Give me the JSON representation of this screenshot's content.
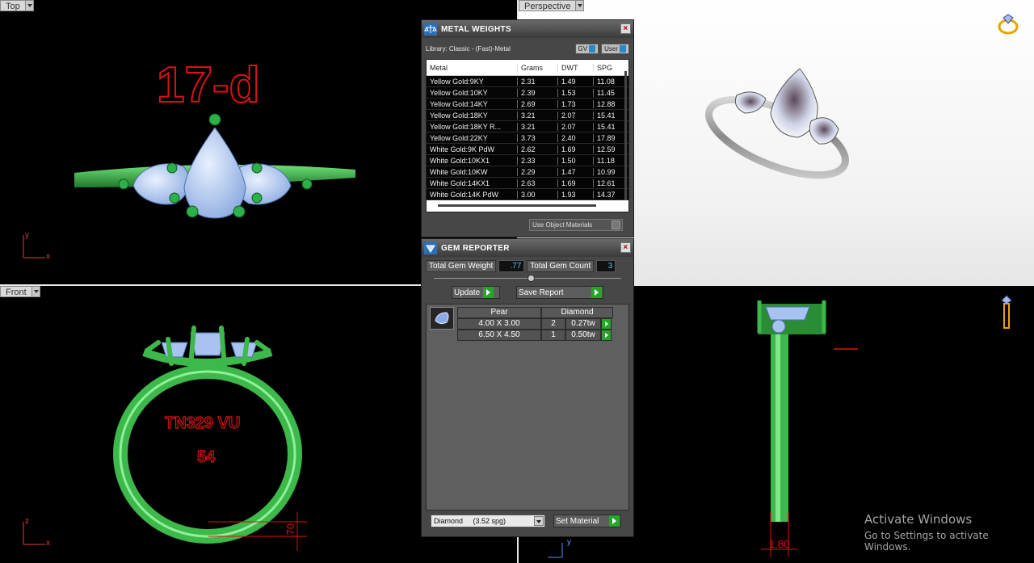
{
  "viewports": {
    "top": {
      "label": "Top",
      "design_text": "17-d",
      "axis_x": "x",
      "axis_y": "y"
    },
    "perspective": {
      "label": "Perspective"
    },
    "front": {
      "label": "Front",
      "engraving_line1": "TN329 VU",
      "engraving_line2": "54",
      "dimension": ".70",
      "axis_x": "x",
      "axis_z": "z"
    },
    "right": {
      "dimension": "1.80",
      "axis_y": "y"
    }
  },
  "metal_weights": {
    "title": "METAL WEIGHTS",
    "library": "Library: Classic - (Fast)-Metal",
    "gv_label": "GV",
    "user_label": "User",
    "columns": [
      "Metal",
      "Grams",
      "DWT",
      "SPG"
    ],
    "rows": [
      {
        "metal": "Yellow Gold:9KY",
        "grams": "2.31",
        "dwt": "1.49",
        "spg": "11.08"
      },
      {
        "metal": "Yellow Gold:10KY",
        "grams": "2.39",
        "dwt": "1.53",
        "spg": "11.45"
      },
      {
        "metal": "Yellow Gold:14KY",
        "grams": "2.69",
        "dwt": "1.73",
        "spg": "12.88"
      },
      {
        "metal": "Yellow Gold:18KY",
        "grams": "3.21",
        "dwt": "2.07",
        "spg": "15.41"
      },
      {
        "metal": "Yellow Gold:18KY R...",
        "grams": "3.21",
        "dwt": "2.07",
        "spg": "15.41"
      },
      {
        "metal": "Yellow Gold:22KY",
        "grams": "3.73",
        "dwt": "2.40",
        "spg": "17.89"
      },
      {
        "metal": "White Gold:9K PdW",
        "grams": "2.62",
        "dwt": "1.69",
        "spg": "12.59"
      },
      {
        "metal": "White Gold:10KX1",
        "grams": "2.33",
        "dwt": "1.50",
        "spg": "11.18"
      },
      {
        "metal": "White Gold:10KW",
        "grams": "2.29",
        "dwt": "1.47",
        "spg": "10.99"
      },
      {
        "metal": "White Gold:14KX1",
        "grams": "2.63",
        "dwt": "1.69",
        "spg": "12.61"
      },
      {
        "metal": "White Gold:14K PdW",
        "grams": "3.00",
        "dwt": "1.93",
        "spg": "14.37"
      }
    ],
    "use_object_materials": "Use Object Materials"
  },
  "gem_reporter": {
    "title": "GEM REPORTER",
    "total_weight_label": "Total Gem Weight",
    "total_weight_value": ".77",
    "total_count_label": "Total Gem Count",
    "total_count_value": "3",
    "update_label": "Update",
    "save_report_label": "Save Report",
    "shape": "Pear",
    "material": "Diamond",
    "gems": [
      {
        "size": "4.00 X 3.00",
        "count": "2",
        "weight": "0.27tw"
      },
      {
        "size": "6.50 X 4.50",
        "count": "1",
        "weight": "0.50tw"
      }
    ],
    "material_select": "Diamond     (3.52 spg)",
    "set_material_label": "Set Material"
  },
  "watermark": {
    "line1": "Activate Windows",
    "line2": "Go to Settings to activate Windows."
  },
  "colors": {
    "ring_green": "#3db84a",
    "gem_blue": "#a9c3f0",
    "annotation_red": "#e01010",
    "panel_bg": "#474747"
  }
}
